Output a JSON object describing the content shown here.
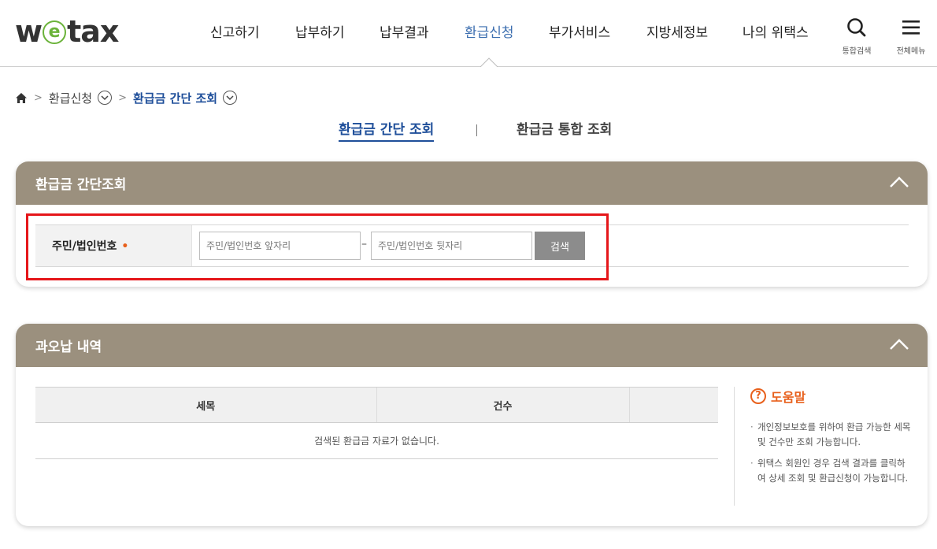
{
  "header": {
    "logo": {
      "prefix": "w",
      "e": "e",
      "suffix": "tax"
    },
    "nav": [
      {
        "label": "신고하기",
        "active": false
      },
      {
        "label": "납부하기",
        "active": false
      },
      {
        "label": "납부결과",
        "active": false
      },
      {
        "label": "환급신청",
        "active": true
      },
      {
        "label": "부가서비스",
        "active": false
      },
      {
        "label": "지방세정보",
        "active": false
      },
      {
        "label": "나의 위택스",
        "active": false
      }
    ],
    "search_label": "통합검색",
    "menu_label": "전체메뉴"
  },
  "breadcrumb": {
    "level1": "환급신청",
    "level2": "환급금 간단 조회"
  },
  "subtabs": {
    "active": "환급금 간단 조회",
    "inactive": "환급금 통합 조회"
  },
  "search_panel": {
    "title": "환급금 간단조회",
    "field_label": "주민/법인번호",
    "required_mark": "•",
    "front_placeholder": "주민/법인번호 앞자리",
    "back_placeholder": "주민/법인번호 뒷자리",
    "dash": "–",
    "search_button": "검색"
  },
  "overpay_panel": {
    "title": "과오납 내역",
    "columns": [
      "세목",
      "건수",
      ""
    ],
    "empty_message": "검색된 환급금 자료가 없습니다."
  },
  "help": {
    "title": "도움말",
    "items": [
      "개인정보보호를 위하여 환급 가능한 세목 및 건수만 조회 가능합니다.",
      "위택스 회원인 경우 검색 결과를 클릭하여 상세 조회 및 환급신청이 가능합니다."
    ]
  },
  "colors": {
    "panel_header": "#9b907e",
    "active_nav": "#3d6fb0",
    "highlight": "#e5161a",
    "help_accent": "#e8601c"
  }
}
